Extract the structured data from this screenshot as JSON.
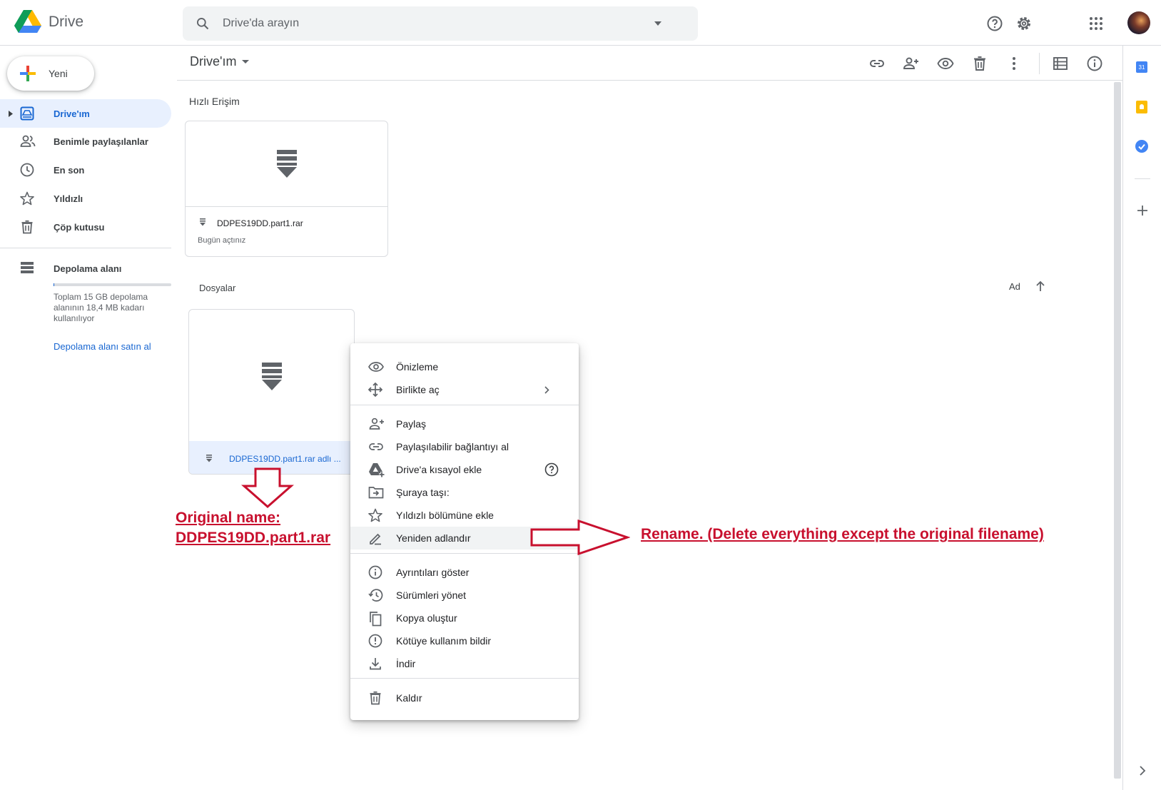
{
  "header": {
    "app_title": "Drive",
    "search_placeholder": "Drive'da arayın"
  },
  "sidebar": {
    "new_label": "Yeni",
    "items": [
      {
        "label": "Drive'ım",
        "icon": "my-drive-icon",
        "active": true
      },
      {
        "label": "Benimle paylaşılanlar",
        "icon": "shared-people-icon"
      },
      {
        "label": "En son",
        "icon": "clock-icon"
      },
      {
        "label": "Yıldızlı",
        "icon": "star-icon"
      },
      {
        "label": "Çöp kutusu",
        "icon": "trash-icon"
      }
    ],
    "storage_label": "Depolama alanı",
    "storage_text": [
      "Toplam 15 GB depolama",
      "alanının 18,4 MB kadarı",
      "kullanılıyor"
    ],
    "buy_storage": "Depolama alanı satın al"
  },
  "toolbar": {
    "breadcrumb": "Drive'ım"
  },
  "quick_access": {
    "title": "Hızlı Erişim",
    "file_name": "DDPES19DD.part1.rar",
    "subtitle": "Bugün açtınız"
  },
  "files": {
    "title": "Dosyalar",
    "sort_label": "Ad",
    "file_name": "DDPES19DD.part1.rar adlı ..."
  },
  "context_menu": {
    "groups": [
      [
        {
          "label": "Önizleme",
          "icon": "eye-icon"
        },
        {
          "label": "Birlikte aç",
          "icon": "move-arrows-icon",
          "submenu": true
        }
      ],
      [
        {
          "label": "Paylaş",
          "icon": "person-add-icon"
        },
        {
          "label": "Paylaşılabilir bağlantıyı al",
          "icon": "link-icon"
        },
        {
          "label": "Drive'a kısayol ekle",
          "icon": "drive-shortcut-icon",
          "help": true
        },
        {
          "label": "Şuraya taşı:",
          "icon": "move-folder-icon"
        },
        {
          "label": "Yıldızlı bölümüne ekle",
          "icon": "star-icon"
        },
        {
          "label": "Yeniden adlandır",
          "icon": "pencil-icon",
          "highlighted": true
        }
      ],
      [
        {
          "label": "Ayrıntıları göster",
          "icon": "info-icon"
        },
        {
          "label": "Sürümleri yönet",
          "icon": "history-icon"
        },
        {
          "label": "Kopya oluştur",
          "icon": "copy-icon"
        },
        {
          "label": "Kötüye kullanım bildir",
          "icon": "report-icon"
        },
        {
          "label": "İndir",
          "icon": "download-icon"
        }
      ],
      [
        {
          "label": "Kaldır",
          "icon": "trash-icon"
        }
      ]
    ]
  },
  "annotations": {
    "original_line1": "Original name:",
    "original_line2": "DDPES19DD.part1.rar",
    "rename_note": "Rename. (Delete everything except the original filename)"
  },
  "colors": {
    "accent": "#1967d2",
    "active_bg": "#e8f0fe",
    "annotation_red": "#c8102e"
  }
}
